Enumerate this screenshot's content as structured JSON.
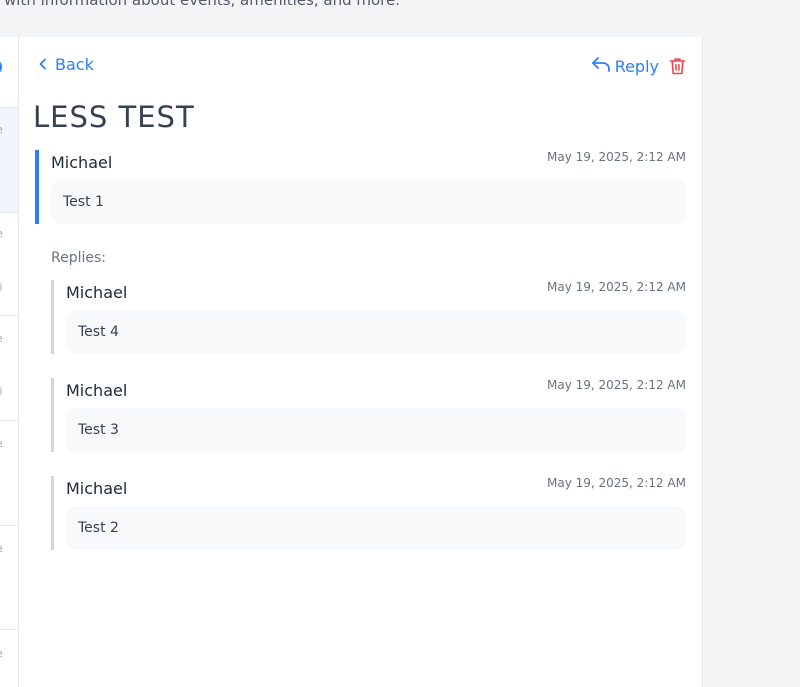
{
  "page": {
    "intro_text": "with information about events, amenities, and more."
  },
  "nav": {
    "back_label": "Back",
    "reply_label": "Reply"
  },
  "thread": {
    "title": "LESS TEST",
    "message": {
      "author": "Michael",
      "timestamp": "May 19, 2025, 2:12 AM",
      "body": "Test 1"
    },
    "replies_label": "Replies:",
    "replies": [
      {
        "author": "Michael",
        "timestamp": "May 19, 2025, 2:12 AM",
        "body": "Test 4"
      },
      {
        "author": "Michael",
        "timestamp": "May 19, 2025, 2:12 AM",
        "body": "Test 3"
      },
      {
        "author": "Michael",
        "timestamp": "May 19, 2025, 2:12 AM",
        "body": "Test 2"
      }
    ]
  },
  "icons": {
    "back": "chevron-left-icon",
    "reply": "reply-arrow-icon",
    "delete": "trash-icon"
  },
  "colors": {
    "accent": "#2f80ed",
    "danger": "#e5484d",
    "reply_border": "#d1d5db"
  }
}
